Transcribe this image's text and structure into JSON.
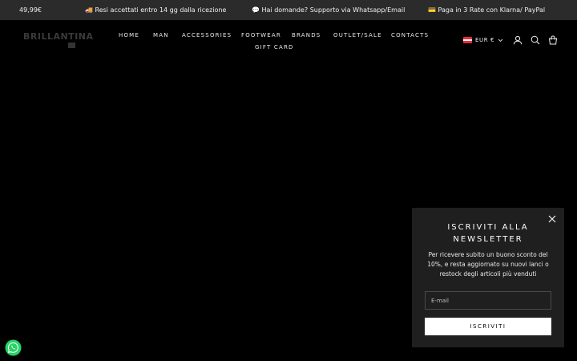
{
  "announcement": {
    "items": [
      "49,99€",
      "🚚 Resi accettati entro 14 gg dalla ricezione",
      "💬 Hai domande? Supporto via Whatsapp/Email",
      "💳 Paga in 3 Rate con Klarna/ PayPal"
    ]
  },
  "header": {
    "logo_text": "BRILLANTINA",
    "nav": [
      "HOME",
      "MAN",
      "ACCESSORIES",
      "FOOTWEAR",
      "BRANDS",
      "OUTLET/SALE",
      "CONTACTS",
      "GIFT CARD"
    ],
    "currency": "EUR €",
    "icons": [
      "account-icon",
      "search-icon",
      "cart-icon"
    ]
  },
  "newsletter": {
    "title_line1": "ISCRIVITI ALLA",
    "title_line2": "NEWSLETTER",
    "description": "Per ricevere subito un buono sconto del 10%, e resta aggiornato su nuovi lanci o restock degli articoli più venduti",
    "email_placeholder": "E-mail",
    "button_label": "ISCRIVITI"
  },
  "colors": {
    "background": "#000000",
    "announcement_bar": "#2b2b2b",
    "popup": "#1f1f1f",
    "whatsapp": "#25d366"
  }
}
